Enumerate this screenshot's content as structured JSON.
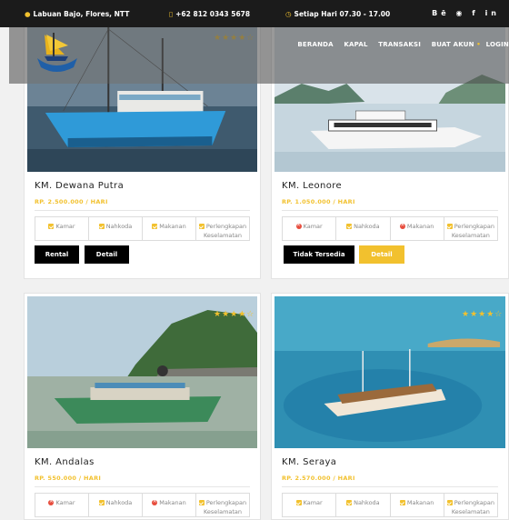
{
  "topbar": {
    "location": "Labuan Bajo, Flores, NTT",
    "phone": "+62 812 0343 5678",
    "hours": "Setiap Hari 07.30 - 17.00",
    "social": [
      "Bē",
      "◉",
      "f",
      "in"
    ]
  },
  "nav": {
    "items": [
      "BERANDA",
      "KAPAL",
      "TRANSAKSI",
      "BUAT AKUN",
      "LOGIN"
    ],
    "separator": "•"
  },
  "colors": {
    "accent": "#f2c12e",
    "dark": "#000000",
    "unavailable": "#e74c3c"
  },
  "boats": [
    {
      "name": "KM. Dewana Putra",
      "price": "RP. 2.500.000 / HARI",
      "stars": 4,
      "features": [
        {
          "label": "Kamar",
          "available": true
        },
        {
          "label": "Nahkoda",
          "available": true
        },
        {
          "label": "Makanan",
          "available": true
        },
        {
          "label": "Perlengkapan",
          "label2": "Keselamatan",
          "available": true
        }
      ],
      "buttons": [
        {
          "label": "Rental",
          "style": "dark"
        },
        {
          "label": "Detail",
          "style": "dark"
        }
      ]
    },
    {
      "name": "KM. Leonore",
      "price": "RP. 1.050.000 / HARI",
      "stars": 4,
      "features": [
        {
          "label": "Kamar",
          "available": false
        },
        {
          "label": "Nahkoda",
          "available": true
        },
        {
          "label": "Makanan",
          "available": false
        },
        {
          "label": "Perlengkapan",
          "label2": "Keselamatan",
          "available": true
        }
      ],
      "buttons": [
        {
          "label": "Tidak Tersedia",
          "style": "dark"
        },
        {
          "label": "Detail",
          "style": "accent"
        }
      ]
    },
    {
      "name": "KM. Andalas",
      "price": "RP. 550.000 / HARI",
      "stars": 4,
      "features": [
        {
          "label": "Kamar",
          "available": false
        },
        {
          "label": "Nahkoda",
          "available": true
        },
        {
          "label": "Makanan",
          "available": false
        },
        {
          "label": "Perlengkapan",
          "label2": "Keselamatan",
          "available": true
        }
      ]
    },
    {
      "name": "KM. Seraya",
      "price": "RP. 2.570.000 / HARI",
      "stars": 4,
      "features": [
        {
          "label": "Kamar",
          "available": true
        },
        {
          "label": "Nahkoda",
          "available": true
        },
        {
          "label": "Makanan",
          "available": true
        },
        {
          "label": "Perlengkapan",
          "label2": "Keselamatan",
          "available": true
        }
      ]
    }
  ]
}
